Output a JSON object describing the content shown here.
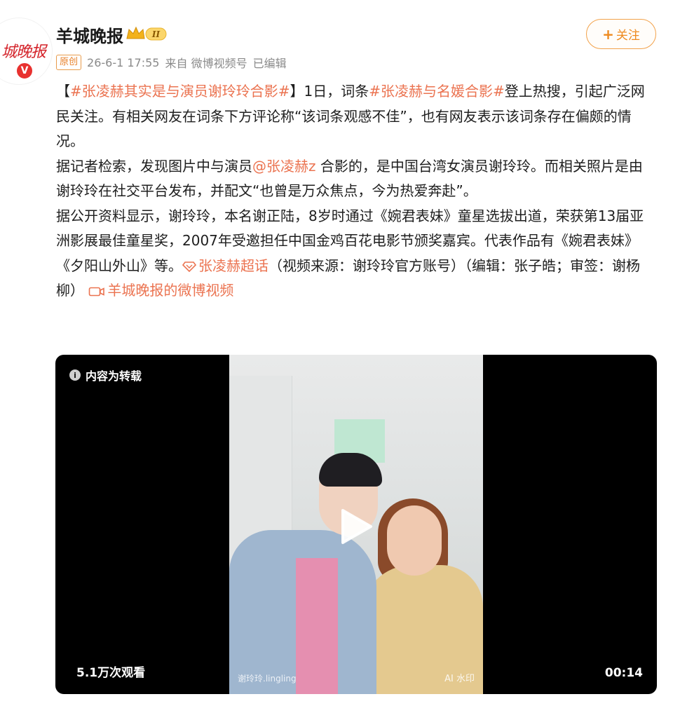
{
  "avatar": {
    "logo_text": "城晚报",
    "badge": "V"
  },
  "post": {
    "username": "羊城晚报",
    "member_level": "II",
    "follow_label": "关注",
    "original_badge": "原创",
    "timestamp": "26-6-1 17:55",
    "source": "来自 微博视频号",
    "edited": "已编辑"
  },
  "content": {
    "p1": {
      "bracket_open": "【",
      "topic1": "#张凌赫其实是与演员谢玲玲合影#",
      "bracket_close": "】",
      "t1": "1日，词条",
      "topic2": "#张凌赫与名媛合影#",
      "t2": "登上热搜，引起广泛网民关注。有相关网友在词条下方评论称“该词条观感不佳”，也有网友表示该词条存在偏颇的情况。"
    },
    "p2": {
      "t1": "据记者检索，发现图片中与演员",
      "mention": "@张凌赫z",
      "t2": "合影的，是中国台湾女演员谢玲玲。而相关照片是由谢玲玲在社交平台发布，并配文“也曾是万众焦点，今为热爱奔赴”。"
    },
    "p3": {
      "t1": "据公开资料显示，谢玲玲，本名谢正陆，8岁时通过《婉君表妹》童星选拔出道，荣获第13届亚洲影展最佳童星奖，2007年受邀担任中国金鸡百花电影节颁奖嘉宾。代表作品有《婉君表妹》《夕阳山外山》等。",
      "supertopic": "张凌赫超话",
      "t2": "（视频来源：谢玲玲官方账号）（编辑：张子皓；审签：谢杨柳）",
      "video_link": "羊城晚报的微博视频"
    }
  },
  "video": {
    "repost_tag": "内容为转载",
    "views": "5.1万次观看",
    "duration": "00:14",
    "watermark": "谢玲玲.lingling",
    "ai_mark": "AI 水印"
  },
  "colors": {
    "accent": "#eb7350",
    "follow": "#ee8a1e",
    "verified": "#e8312f"
  },
  "icons": [
    "crown-icon",
    "verified-icon",
    "plus-icon",
    "diamond-icon",
    "video-camera-icon",
    "info-icon",
    "play-icon"
  ]
}
